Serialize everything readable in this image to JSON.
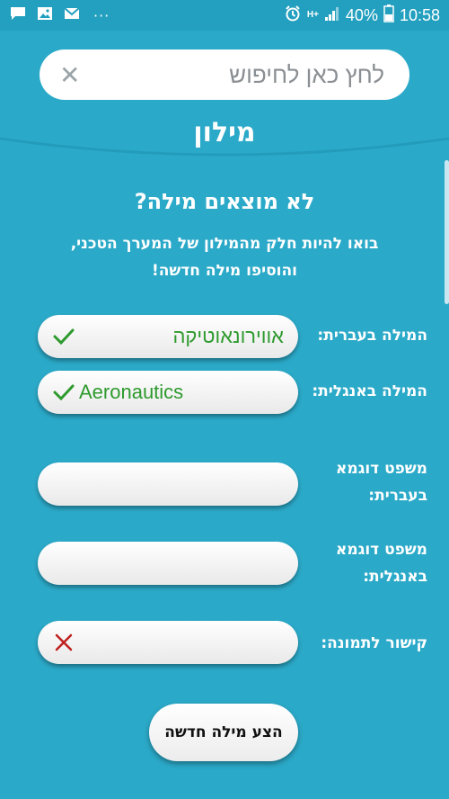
{
  "status_bar": {
    "network": "H+",
    "battery": "40%",
    "time": "10:58",
    "dots": "···"
  },
  "search": {
    "placeholder": "לחץ כאן לחיפוש"
  },
  "page_title": "מילון",
  "heading": "לא מוצאים מילה?",
  "subtext": {
    "line1": "בואו להיות חלק מהמילון של המערך הטכני,",
    "line2": "והוסיפו מילה חדשה!"
  },
  "fields": {
    "hebrew_word": {
      "label": "המילה בעברית:",
      "value": "אווירונאוטיקה"
    },
    "english_word": {
      "label": "המילה באנגלית:",
      "value": "Aeronautics"
    },
    "hebrew_sentence": {
      "label_line1": "משפט דוגמא",
      "label_line2": "בעברית:",
      "value": ""
    },
    "english_sentence": {
      "label_line1": "משפט דוגמא",
      "label_line2": "באנגלית:",
      "value": ""
    },
    "image_link": {
      "label": "קישור לתמונה:",
      "value": ""
    }
  },
  "submit_label": "הצע מילה חדשה",
  "colors": {
    "background": "#2ba9c8",
    "valid": "#2e9a2e",
    "invalid": "#c0201f"
  }
}
